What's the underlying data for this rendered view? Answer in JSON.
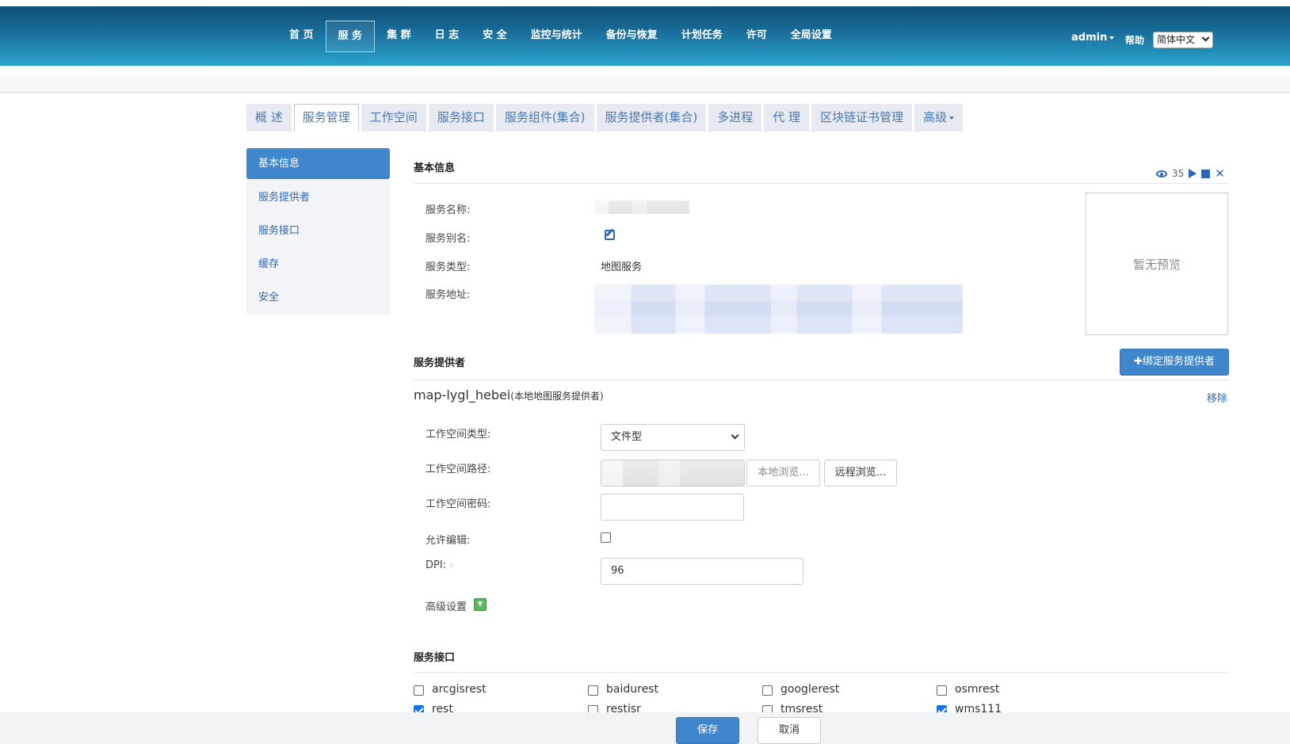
{
  "header": {
    "nav": [
      "首 页",
      "服 务",
      "集 群",
      "日 志",
      "安 全",
      "监控与统计",
      "备份与恢复",
      "计划任务",
      "许可",
      "全局设置"
    ],
    "active_index": 1,
    "user": "admin",
    "help": "帮助",
    "language": "简体中文"
  },
  "tabs": {
    "items": [
      "概 述",
      "服务管理",
      "工作空间",
      "服务接口",
      "服务组件(集合)",
      "服务提供者(集合)",
      "多进程",
      "代 理",
      "区块链证书管理",
      "高级"
    ],
    "active_index": 1
  },
  "sidebar": {
    "items": [
      "基本信息",
      "服务提供者",
      "服务接口",
      "缓存",
      "安全"
    ],
    "active_index": 0
  },
  "basic": {
    "title": "基本信息",
    "view_count": "35",
    "name_label": "服务名称:",
    "name_value": "",
    "alias_label": "服务别名:",
    "type_label": "服务类型:",
    "type_value": "地图服务",
    "address_label": "服务地址:",
    "address_value": "",
    "preview_text": "暂无预览"
  },
  "provider": {
    "title": "服务提供者",
    "bind_button": "✚绑定服务提供者",
    "name": "map-lygl_hebei",
    "kind": "(本地地图服务提供者)",
    "remove": "移除",
    "workspace_type_label": "工作空间类型:",
    "workspace_type_value": "文件型",
    "workspace_path_label": "工作空间路径:",
    "workspace_path_value": "",
    "local_browse": "本地浏览...",
    "remote_browse": "远程浏览...",
    "workspace_password_label": "工作空间密码:",
    "workspace_password_value": "",
    "allow_edit_label": "允许编辑:",
    "allow_edit_checked": false,
    "dpi_label": "DPI:",
    "dpi_value": "96",
    "advanced_label": "高级设置"
  },
  "interfaces": {
    "title": "服务接口",
    "items": [
      {
        "label": "arcgisrest",
        "checked": false
      },
      {
        "label": "baidurest",
        "checked": false
      },
      {
        "label": "googlerest",
        "checked": false
      },
      {
        "label": "osmrest",
        "checked": false
      },
      {
        "label": "rest",
        "checked": true
      },
      {
        "label": "restjsr",
        "checked": false
      },
      {
        "label": "tmsrest",
        "checked": false
      },
      {
        "label": "wms111",
        "checked": true
      }
    ]
  },
  "footer": {
    "save": "保存",
    "cancel": "取消"
  }
}
